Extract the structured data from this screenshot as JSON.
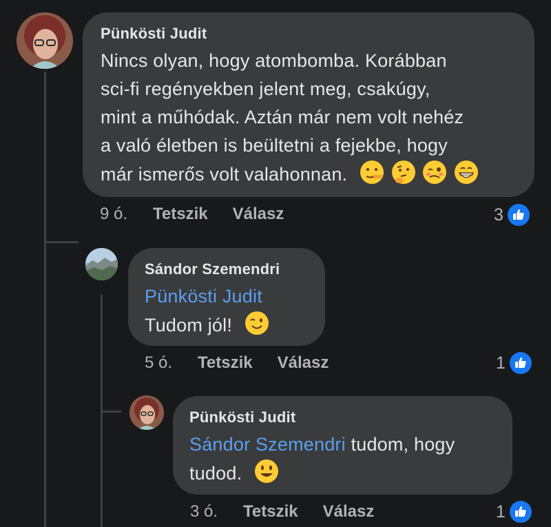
{
  "comments": [
    {
      "author": "Pünkösti Judit",
      "text_lines": [
        "Nincs olyan, hogy atombomba. Korábban",
        "sci-fi regényekben jelent meg, csakúgy,",
        "mint a műhódak. Aztán már nem volt nehéz",
        "a való életben is beültetni a fejekbe, hogy",
        "már ismerős volt valahonnan."
      ],
      "emojis": [
        "lying-face",
        "thinking-face",
        "woozy-face",
        "grinning-face"
      ],
      "time": "9 ó.",
      "like_label": "Tetszik",
      "reply_label": "Válasz",
      "reaction_count": "3"
    },
    {
      "author": "Sándor Szemendri",
      "mention": "Pünkösti Judit",
      "text": "Tudom jól!",
      "emojis": [
        "winking-face"
      ],
      "time": "5 ó.",
      "like_label": "Tetszik",
      "reply_label": "Válasz",
      "reaction_count": "1"
    },
    {
      "author": "Pünkösti Judit",
      "mention": "Sándor Szemendri",
      "text_after_mention": " tudom, hogy",
      "text_line2": "tudod.",
      "emojis": [
        "smiling-face"
      ],
      "time": "3 ó.",
      "like_label": "Tetszik",
      "reply_label": "Válasz",
      "reaction_count": "1"
    }
  ],
  "colors": {
    "background": "#18191a",
    "bubble": "#3a3b3c",
    "mention": "#5a9ff0",
    "like_blue": "#1877f2"
  }
}
